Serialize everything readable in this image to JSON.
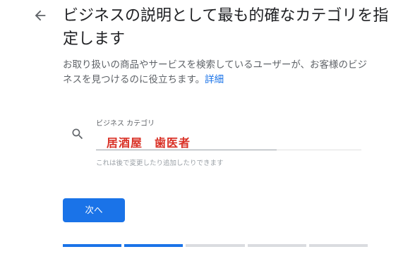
{
  "header": {
    "title": "ビジネスの説明として最も的確なカテゴリを指定します",
    "back_icon": "arrow-back-icon"
  },
  "description": {
    "text": "お取り扱いの商品やサービスを検索しているユーザーが、お客様のビジネスを見つけるのに役立ちます。",
    "link_label": "詳細"
  },
  "category_field": {
    "icon": "search-icon",
    "label": "ビジネス カテゴリ",
    "value": "居酒屋　歯医者",
    "helper": "これは後で変更したり追加したりできます"
  },
  "actions": {
    "next_label": "次へ"
  },
  "progress": {
    "total_steps": 5,
    "completed_steps": 2
  },
  "colors": {
    "accent": "#1a73e8",
    "value_text": "#d93025"
  }
}
